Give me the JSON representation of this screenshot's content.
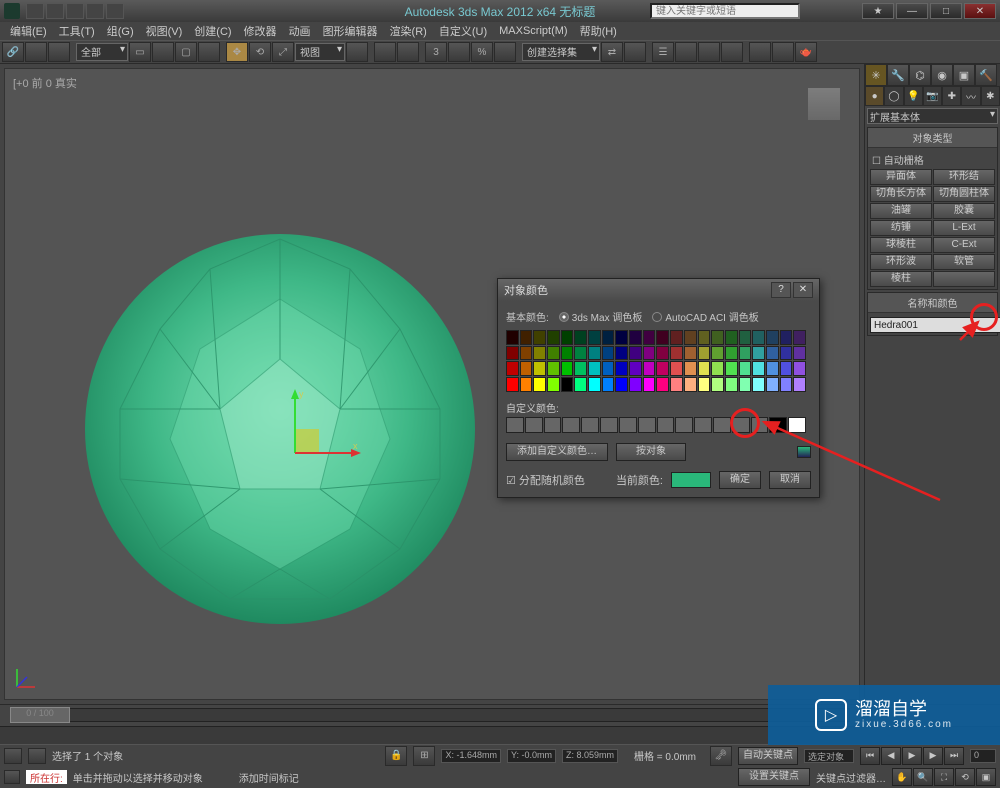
{
  "app": {
    "title": "Autodesk 3ds Max  2012  x64   无标题",
    "search_placeholder": "键入关键字或短语"
  },
  "menu": [
    "编辑(E)",
    "工具(T)",
    "组(G)",
    "视图(V)",
    "创建(C)",
    "修改器",
    "动画",
    "图形编辑器",
    "渲染(R)",
    "自定义(U)",
    "MAXScript(M)",
    "帮助(H)"
  ],
  "toolbar": {
    "filter": "全部",
    "view_label": "视图",
    "sel_label": "创建选择集"
  },
  "viewport": {
    "label": "[+0 前 0 真实"
  },
  "panel": {
    "category": "扩展基本体",
    "obj_type_title": "对象类型",
    "auto_grid": "自动栅格",
    "buttons": [
      [
        "异面体",
        "环形结"
      ],
      [
        "切角长方体",
        "切角圆柱体"
      ],
      [
        "油罐",
        "胶囊"
      ],
      [
        "纺锤",
        "L-Ext"
      ],
      [
        "球棱柱",
        "C-Ext"
      ],
      [
        "环形波",
        "软管"
      ],
      [
        "棱柱",
        ""
      ]
    ],
    "name_color_title": "名称和颜色",
    "obj_name": "Hedra001",
    "obj_color": "#2ab77a"
  },
  "dialog": {
    "title": "对象颜色",
    "basic_colors": "基本颜色:",
    "hue_3dsmax": "3ds Max 调色板",
    "hue_acad": "AutoCAD ACI 调色板",
    "custom_colors": "自定义颜色:",
    "add_custom": "添加自定义颜色…",
    "by_object": "按对象",
    "assign_random": "分配随机颜色",
    "current_color_label": "当前颜色:",
    "ok": "确定",
    "cancel": "取消",
    "current_color": "#2ab77a"
  },
  "status": {
    "sel_count": "选择了 1 个对象",
    "x": "X: -1.648mm",
    "y": "Y: -0.0mm",
    "z": "Z: 8.059mm",
    "grid": "栅格 = 0.0mm",
    "hint": "单击并拖动以选择并移动对象",
    "add_time": "添加时间标记",
    "auto_key": "自动关键点",
    "sel_key": "选定对象",
    "set_key": "设置关键点",
    "key_filter": "关键点过滤器…",
    "frame": "0",
    "timeline": "0 / 100",
    "prompt_label": "所在行:"
  },
  "watermark": {
    "brand": "溜溜自学",
    "url": "zixue.3d66.com"
  },
  "chart_data": {
    "type": "table",
    "title": "3ds Max palette swatches (approx hex)",
    "rows": 4,
    "cols": 22,
    "values": [
      [
        "#200000",
        "#402000",
        "#404000",
        "#204000",
        "#004000",
        "#004020",
        "#004040",
        "#002040",
        "#000040",
        "#200040",
        "#400040",
        "#400020",
        "#602020",
        "#604020",
        "#606020",
        "#406020",
        "#206020",
        "#206040",
        "#206060",
        "#204060",
        "#202060",
        "#402060"
      ],
      [
        "#800000",
        "#804000",
        "#808000",
        "#408000",
        "#008000",
        "#008040",
        "#008080",
        "#004080",
        "#000080",
        "#400080",
        "#800080",
        "#800040",
        "#a03030",
        "#a06030",
        "#a0a030",
        "#60a030",
        "#30a030",
        "#30a060",
        "#30a0a0",
        "#3060a0",
        "#3030a0",
        "#6030a0"
      ],
      [
        "#c00000",
        "#c06000",
        "#c0c000",
        "#60c000",
        "#00c000",
        "#00c060",
        "#00c0c0",
        "#0060c0",
        "#0000c0",
        "#6000c0",
        "#c000c0",
        "#c00060",
        "#e05050",
        "#e09050",
        "#e0e050",
        "#90e050",
        "#50e050",
        "#50e090",
        "#50e0e0",
        "#5090e0",
        "#5050e0",
        "#9050e0"
      ],
      [
        "#ff0000",
        "#ff8000",
        "#ffff00",
        "#80ff00",
        "#000000",
        "#00ff80",
        "#00ffff",
        "#0080ff",
        "#0000ff",
        "#8000ff",
        "#ff00ff",
        "#ff0080",
        "#ff8080",
        "#ffb080",
        "#ffff80",
        "#b0ff80",
        "#80ff80",
        "#80ffb0",
        "#80ffff",
        "#80b0ff",
        "#8080ff",
        "#b080ff"
      ]
    ]
  }
}
